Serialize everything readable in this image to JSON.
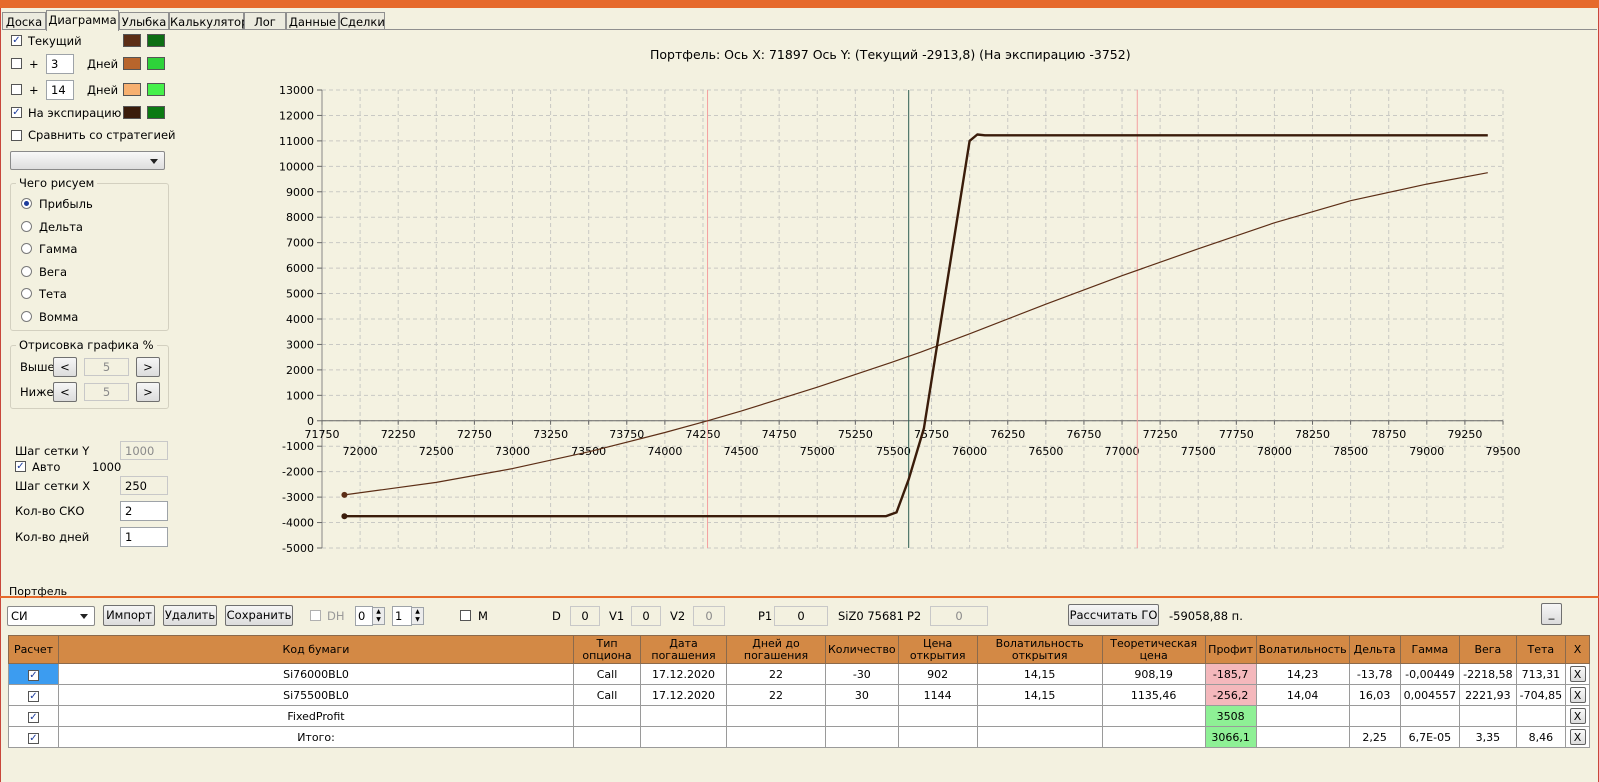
{
  "tabs": [
    "Доска",
    "Диаграмма",
    "Улыбка",
    "Калькулятор",
    "Лог",
    "Данные",
    "Сделки"
  ],
  "left": {
    "current_label": "Текущий",
    "plus": "+",
    "days_label": "Дней",
    "days1": "3",
    "days2": "14",
    "expiry_label": "На экспирацию",
    "compare_label": "Сравнить со стратегией",
    "draw_group_title": "Чего рисуем",
    "draw_options": [
      "Прибыль",
      "Дельта",
      "Гамма",
      "Вега",
      "Тета",
      "Вомма"
    ],
    "render_group_title": "Отрисовка графика %",
    "above_label": "Выше",
    "below_label": "Ниже",
    "above_value": "5",
    "below_value": "5",
    "left_btn": "<",
    "right_btn": ">",
    "grid_y_label": "Шаг сетки Y",
    "grid_y_value": "1000",
    "auto_label": "Авто",
    "auto_value": "1000",
    "grid_x_label": "Шаг сетки X",
    "grid_x_value": "250",
    "sko_label": "Кол-во СКО",
    "sko_value": "2",
    "days_count_label": "Кол-во дней",
    "days_count_value": "1"
  },
  "colors": {
    "current_a": "#5c2e16",
    "current_b": "#0d6e14",
    "d3_a": "#b8652c",
    "d3_b": "#2ed23a",
    "d14_a": "#f7b070",
    "d14_b": "#45f04a",
    "exp_a": "#3a1c0a",
    "exp_b": "#0b7a12"
  },
  "chart_title": "Портфель:  Ось X:  71897  Ось Y:   (Текущий -2913,8)   (На экспирацию  -3752)",
  "chart_data": {
    "type": "line",
    "x_range": [
      71750,
      79500
    ],
    "ylim": [
      -5000,
      13000
    ],
    "y_ticks": [
      13000,
      12000,
      11000,
      10000,
      9000,
      8000,
      7000,
      6000,
      5000,
      4000,
      3000,
      2000,
      1000,
      0,
      -1000,
      -2000,
      -3000,
      -4000,
      -5000
    ],
    "x_ticks_upper": [
      "71750",
      "72250",
      "72750",
      "73250",
      "73750",
      "74250",
      "74750",
      "75250",
      "75750",
      "76250",
      "76750",
      "77250",
      "77750",
      "78250",
      "78750",
      "79250"
    ],
    "x_ticks_lower": [
      "72000",
      "72500",
      "73000",
      "73500",
      "74000",
      "74500",
      "75000",
      "75500",
      "76000",
      "76500",
      "77000",
      "77500",
      "78000",
      "78500",
      "79000",
      "79500"
    ],
    "vlines": {
      "red1": 74280,
      "green": 75600,
      "red2": 77100
    },
    "series": [
      {
        "name": "Текущий",
        "x": [
          71897,
          72500,
          73000,
          73500,
          74000,
          74280,
          74500,
          75000,
          75500,
          75680,
          76000,
          76500,
          77000,
          77500,
          78000,
          78500,
          79000,
          79400
        ],
        "y": [
          -2913.8,
          -2420,
          -1880,
          -1220,
          -460,
          0,
          380,
          1320,
          2320,
          2700,
          3420,
          4580,
          5700,
          6760,
          7780,
          8650,
          9300,
          9750
        ]
      },
      {
        "name": "На экспирацию",
        "x": [
          71897,
          75000,
          75450,
          75520,
          75600,
          75700,
          76000,
          76050,
          76100,
          77000,
          78000,
          79400
        ],
        "y": [
          -3752,
          -3752,
          -3752,
          -3600,
          -2300,
          -300,
          11000,
          11250,
          11220,
          11220,
          11220,
          11220
        ]
      }
    ]
  },
  "portfolio": {
    "title": "Портфель",
    "asset": "СИ",
    "import_btn": "Импорт",
    "delete_btn": "Удалить",
    "save_btn": "Сохранить",
    "dh_label": "DH",
    "spin1": "0",
    "spin2": "1",
    "m_label": "M",
    "d_label": "D",
    "d_value": "0",
    "v1_label": "V1",
    "v1_value": "0",
    "v2_label": "V2",
    "v2_value": "0",
    "p1_label": "P1",
    "p1_value": "0",
    "siz_text": "SiZ0 75681",
    "p2_label": "P2",
    "p2_value": "0",
    "calc_btn": "Рассчитать ГО",
    "go_value": "-59058,88 п.",
    "min_btn": "_"
  },
  "table": {
    "headers": [
      "Расчет",
      "Код бумаги",
      "Тип опциона",
      "Дата погашения",
      "Дней до погашения",
      "Количество",
      "Цена открытия",
      "Волатильность открытия",
      "Теоретическая цена",
      "Профит",
      "Волатильность",
      "Дельта",
      "Гамма",
      "Вега",
      "Тета",
      "X"
    ],
    "rows": [
      {
        "code": "Si76000BL0",
        "type": "Call",
        "date": "17.12.2020",
        "days": "22",
        "qty": "-30",
        "price": "902",
        "vol_open": "14,15",
        "theo": "908,19",
        "profit": "-185,7",
        "vol": "14,23",
        "delta": "-13,78",
        "gamma": "-0,00449",
        "vega": "-2218,58",
        "theta": "713,31",
        "x": "X"
      },
      {
        "code": "Si75500BL0",
        "type": "Call",
        "date": "17.12.2020",
        "days": "22",
        "qty": "30",
        "price": "1144",
        "vol_open": "14,15",
        "theo": "1135,46",
        "profit": "-256,2",
        "vol": "14,04",
        "delta": "16,03",
        "gamma": "0,004557",
        "vega": "2221,93",
        "theta": "-704,85",
        "x": "X"
      },
      {
        "code": "FixedProfit",
        "type": "",
        "date": "",
        "days": "",
        "qty": "",
        "price": "",
        "vol_open": "",
        "theo": "",
        "profit": "3508",
        "vol": "",
        "delta": "",
        "gamma": "",
        "vega": "",
        "theta": "",
        "x": "X"
      },
      {
        "code": "Итого:",
        "type": "",
        "date": "",
        "days": "",
        "qty": "",
        "price": "",
        "vol_open": "",
        "theo": "",
        "profit": "3066,1",
        "vol": "",
        "delta": "2,25",
        "gamma": "6,7E-05",
        "vega": "3,35",
        "theta": "8,46",
        "x": "X"
      }
    ]
  }
}
